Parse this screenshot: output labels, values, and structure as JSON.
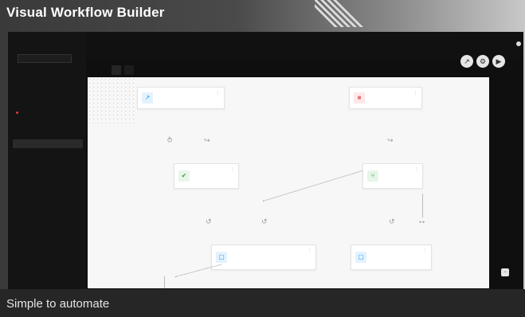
{
  "banner": {
    "title": "Visual Workflow Builder",
    "caption": "Simple to automate"
  },
  "app": {
    "logo": {
      "prefix": "",
      "text": "",
      "accent": ""
    },
    "env_selector": "",
    "sidebar": [
      {
        "label": "",
        "kind": "item"
      },
      {
        "label": "",
        "kind": "item"
      },
      {
        "label": "",
        "kind": "item"
      },
      {
        "label": "",
        "kind": "item"
      },
      {
        "label": "",
        "kind": "active"
      },
      {
        "label": "",
        "kind": "sub"
      },
      {
        "label": "",
        "kind": "sub"
      },
      {
        "label": "",
        "kind": "sel"
      },
      {
        "label": "",
        "kind": "item"
      },
      {
        "label": "",
        "kind": "item"
      },
      {
        "label": "",
        "kind": "item"
      },
      {
        "label": "",
        "kind": "item"
      },
      {
        "label": "",
        "kind": "item"
      },
      {
        "label": "",
        "kind": "item"
      },
      {
        "label": "",
        "kind": "item"
      }
    ],
    "breadcrumb": "",
    "page_title": "",
    "tabs": [
      {
        "label": "",
        "active": true
      },
      {
        "label": "",
        "active": false
      }
    ],
    "canvas_buttons": [
      {
        "icon": "share-icon"
      },
      {
        "icon": "settings-icon"
      },
      {
        "icon": "play-icon"
      }
    ],
    "nodes": [
      {
        "title": "",
        "subtitle": "",
        "icon": "trigger-icon",
        "accent": "#2196f3"
      },
      {
        "title": "",
        "subtitle": "",
        "icon": "webhook-icon",
        "accent": "#e57373"
      },
      {
        "title": "",
        "subtitle": "",
        "icon": "check-icon",
        "accent": "#43a047"
      },
      {
        "title": "",
        "subtitle": "",
        "icon": "branch-icon",
        "accent": "#43a047"
      },
      {
        "title": "",
        "subtitle": "",
        "icon": "action-icon",
        "accent": "#2196f3"
      },
      {
        "title": "",
        "subtitle": "",
        "icon": "action-icon",
        "accent": "#2196f3"
      }
    ],
    "edge_labels": [
      "",
      "",
      "",
      "",
      "",
      "",
      "",
      ""
    ]
  }
}
